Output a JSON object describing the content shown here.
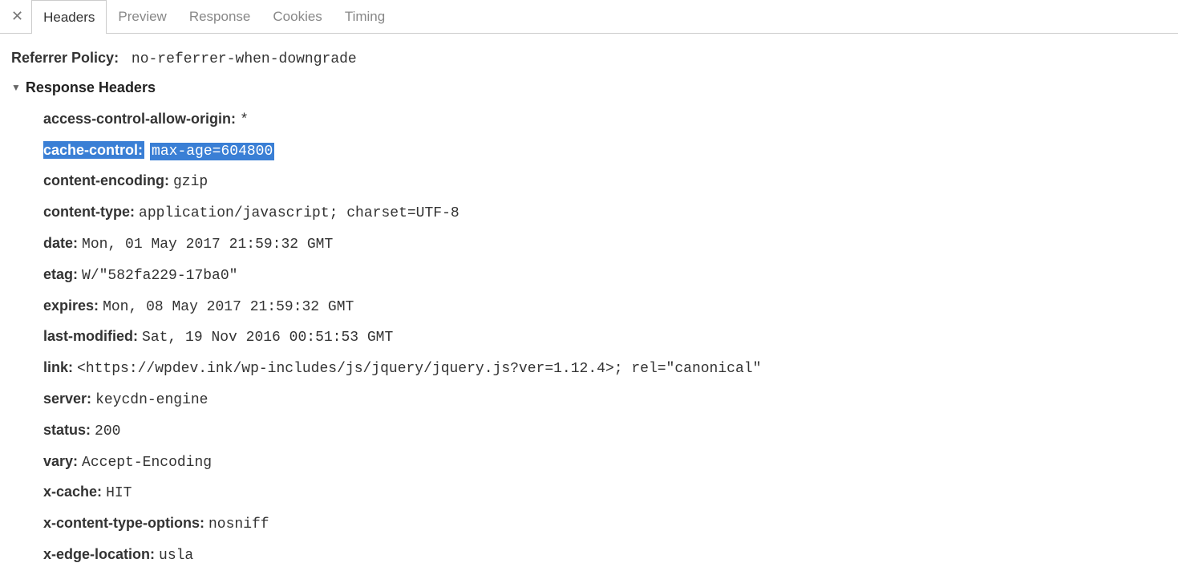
{
  "tabs": {
    "headers": "Headers",
    "preview": "Preview",
    "response": "Response",
    "cookies": "Cookies",
    "timing": "Timing"
  },
  "general": {
    "referrer_policy_key": "Referrer Policy:",
    "referrer_policy_val": "no-referrer-when-downgrade"
  },
  "section_title": "Response Headers",
  "headers": [
    {
      "key": "access-control-allow-origin:",
      "val": "*",
      "hl": false
    },
    {
      "key": "cache-control:",
      "val": "max-age=604800",
      "hl": true
    },
    {
      "key": "content-encoding:",
      "val": "gzip",
      "hl": false
    },
    {
      "key": "content-type:",
      "val": "application/javascript; charset=UTF-8",
      "hl": false
    },
    {
      "key": "date:",
      "val": "Mon, 01 May 2017 21:59:32 GMT",
      "hl": false
    },
    {
      "key": "etag:",
      "val": "W/\"582fa229-17ba0\"",
      "hl": false
    },
    {
      "key": "expires:",
      "val": "Mon, 08 May 2017 21:59:32 GMT",
      "hl": false
    },
    {
      "key": "last-modified:",
      "val": "Sat, 19 Nov 2016 00:51:53 GMT",
      "hl": false
    },
    {
      "key": "link:",
      "val": "<https://wpdev.ink/wp-includes/js/jquery/jquery.js?ver=1.12.4>; rel=\"canonical\"",
      "hl": false
    },
    {
      "key": "server:",
      "val": "keycdn-engine",
      "hl": false
    },
    {
      "key": "status:",
      "val": "200",
      "hl": false
    },
    {
      "key": "vary:",
      "val": "Accept-Encoding",
      "hl": false
    },
    {
      "key": "x-cache:",
      "val": "HIT",
      "hl": false
    },
    {
      "key": "x-content-type-options:",
      "val": "nosniff",
      "hl": false
    },
    {
      "key": "x-edge-location:",
      "val": "usla",
      "hl": false
    }
  ]
}
